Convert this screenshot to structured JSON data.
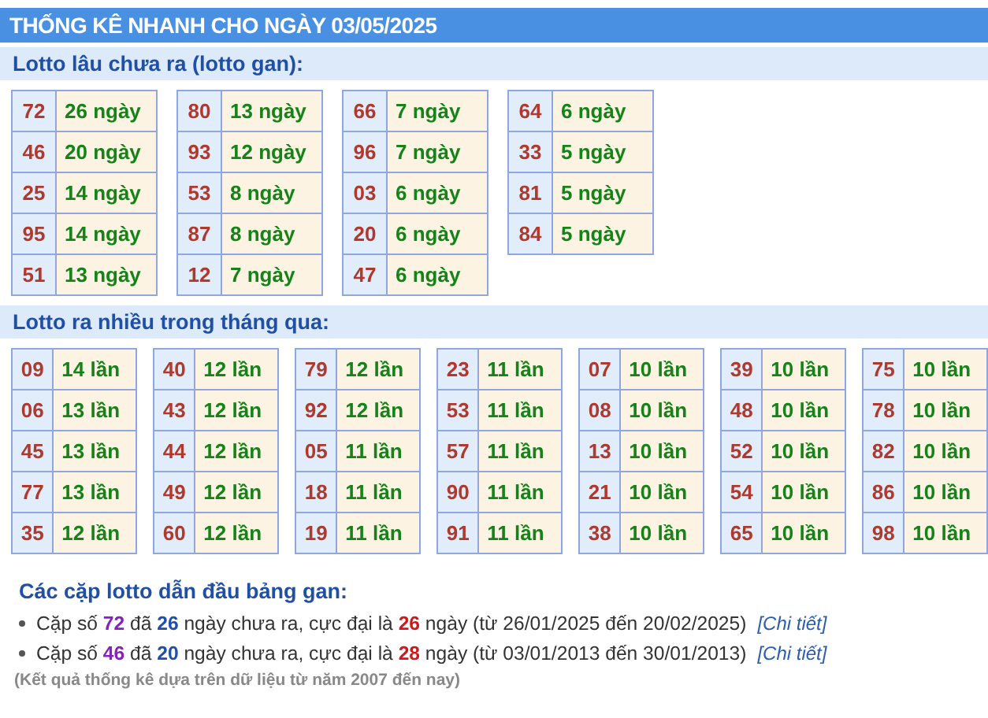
{
  "header": {
    "title": "THỐNG KÊ NHANH CHO NGÀY 03/05/2025"
  },
  "sections": [
    {
      "title": "Lotto lâu chưa ra (lotto gan):",
      "kind": "gan",
      "groups": [
        [
          {
            "number": "72",
            "count": "26 ngày"
          },
          {
            "number": "46",
            "count": "20 ngày"
          },
          {
            "number": "25",
            "count": "14 ngày"
          },
          {
            "number": "95",
            "count": "14 ngày"
          },
          {
            "number": "51",
            "count": "13 ngày"
          }
        ],
        [
          {
            "number": "80",
            "count": "13 ngày"
          },
          {
            "number": "93",
            "count": "12 ngày"
          },
          {
            "number": "53",
            "count": "8 ngày"
          },
          {
            "number": "87",
            "count": "8 ngày"
          },
          {
            "number": "12",
            "count": "7 ngày"
          }
        ],
        [
          {
            "number": "66",
            "count": "7 ngày"
          },
          {
            "number": "96",
            "count": "7 ngày"
          },
          {
            "number": "03",
            "count": "6 ngày"
          },
          {
            "number": "20",
            "count": "6 ngày"
          },
          {
            "number": "47",
            "count": "6 ngày"
          }
        ],
        [
          {
            "number": "64",
            "count": "6 ngày"
          },
          {
            "number": "33",
            "count": "5 ngày"
          },
          {
            "number": "81",
            "count": "5 ngày"
          },
          {
            "number": "84",
            "count": "5 ngày"
          }
        ]
      ]
    },
    {
      "title": "Lotto ra nhiều trong tháng qua:",
      "kind": "frequent",
      "groups": [
        [
          {
            "number": "09",
            "count": "14 lần"
          },
          {
            "number": "06",
            "count": "13 lần"
          },
          {
            "number": "45",
            "count": "13 lần"
          },
          {
            "number": "77",
            "count": "13 lần"
          },
          {
            "number": "35",
            "count": "12 lần"
          }
        ],
        [
          {
            "number": "40",
            "count": "12 lần"
          },
          {
            "number": "43",
            "count": "12 lần"
          },
          {
            "number": "44",
            "count": "12 lần"
          },
          {
            "number": "49",
            "count": "12 lần"
          },
          {
            "number": "60",
            "count": "12 lần"
          }
        ],
        [
          {
            "number": "79",
            "count": "12 lần"
          },
          {
            "number": "92",
            "count": "12 lần"
          },
          {
            "number": "05",
            "count": "11 lần"
          },
          {
            "number": "18",
            "count": "11 lần"
          },
          {
            "number": "19",
            "count": "11 lần"
          }
        ],
        [
          {
            "number": "23",
            "count": "11 lần"
          },
          {
            "number": "53",
            "count": "11 lần"
          },
          {
            "number": "57",
            "count": "11 lần"
          },
          {
            "number": "90",
            "count": "11 lần"
          },
          {
            "number": "91",
            "count": "11 lần"
          }
        ],
        [
          {
            "number": "07",
            "count": "10 lần"
          },
          {
            "number": "08",
            "count": "10 lần"
          },
          {
            "number": "13",
            "count": "10 lần"
          },
          {
            "number": "21",
            "count": "10 lần"
          },
          {
            "number": "38",
            "count": "10 lần"
          }
        ],
        [
          {
            "number": "39",
            "count": "10 lần"
          },
          {
            "number": "48",
            "count": "10 lần"
          },
          {
            "number": "52",
            "count": "10 lần"
          },
          {
            "number": "54",
            "count": "10 lần"
          },
          {
            "number": "65",
            "count": "10 lần"
          }
        ],
        [
          {
            "number": "75",
            "count": "10 lần"
          },
          {
            "number": "78",
            "count": "10 lần"
          },
          {
            "number": "82",
            "count": "10 lần"
          },
          {
            "number": "86",
            "count": "10 lần"
          },
          {
            "number": "98",
            "count": "10 lần"
          }
        ]
      ]
    }
  ],
  "summary": {
    "title": "Các cặp lotto dẫn đầu bảng gan:",
    "pairs": [
      {
        "prefix": "Cặp số",
        "number": "72",
        "mid": "đã",
        "days": "26",
        "text": "ngày chưa ra, cực đại là",
        "max": "26",
        "suffix": "ngày (từ 26/01/2025 đến 20/02/2025)",
        "link": "[Chi tiết]"
      },
      {
        "prefix": "Cặp số",
        "number": "46",
        "mid": "đã",
        "days": "20",
        "text": "ngày chưa ra, cực đại là",
        "max": "28",
        "suffix": "ngày (từ 03/01/2013 đến 30/01/2013)",
        "link": "[Chi tiết]"
      }
    ],
    "note": "(Kết quả thống kê dựa trên dữ liệu từ năm 2007 đến nay)"
  }
}
